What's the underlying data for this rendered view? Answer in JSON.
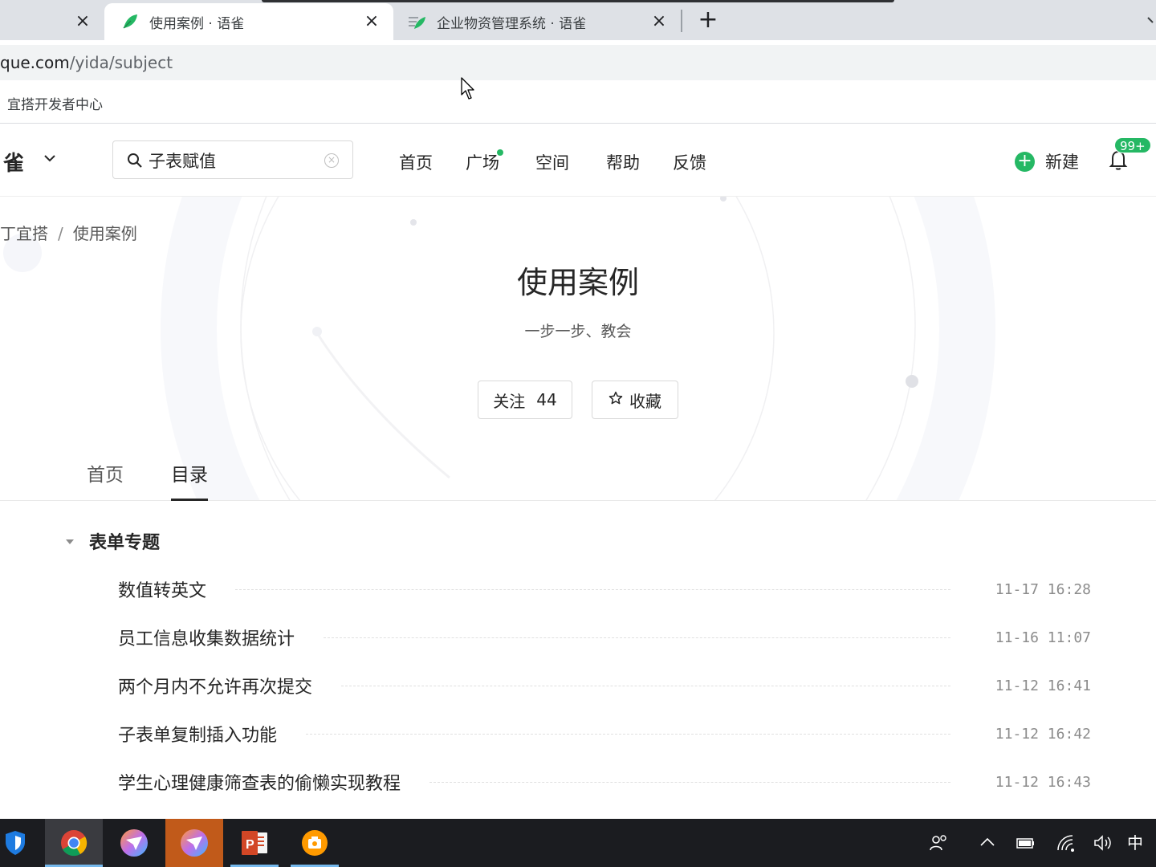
{
  "browser": {
    "tabs": [
      {
        "title": "",
        "active": false
      },
      {
        "title": "使用案例 · 语雀",
        "active": true
      },
      {
        "title": "企业物资管理系统 · 语雀",
        "active": false
      }
    ],
    "url_host": "que.com",
    "url_path": "/yida/subject",
    "bookmark": "宜搭开发者中心"
  },
  "header": {
    "logo": "雀",
    "search_value": "子表赋值",
    "nav": [
      "首页",
      "广场",
      "空间",
      "帮助",
      "反馈"
    ],
    "new_label": "新建",
    "notification_badge": "99+"
  },
  "hero": {
    "breadcrumb": [
      "丁宜搭",
      "使用案例"
    ],
    "breadcrumb_sep": "/",
    "title": "使用案例",
    "subtitle": "一步一步、教会",
    "follow_label": "关注",
    "follow_count": "44",
    "favorite_label": "收藏"
  },
  "tabs": [
    "首页",
    "目录"
  ],
  "catalog": {
    "section_title": "表单专题",
    "docs": [
      {
        "title": "数值转英文",
        "time": "11-17 16:28"
      },
      {
        "title": "员工信息收集数据统计",
        "time": "11-16 11:07"
      },
      {
        "title": "两个月内不允许再次提交",
        "time": "11-12 16:41"
      },
      {
        "title": "子表单复制插入功能",
        "time": "11-12 16:42"
      },
      {
        "title": "学生心理健康筛查表的偷懒实现教程",
        "time": "11-12 16:43"
      }
    ]
  },
  "taskbar": {
    "ime": "中"
  },
  "colors": {
    "brand_green": "#25b864",
    "taskbar_bg": "#1b1c20"
  }
}
